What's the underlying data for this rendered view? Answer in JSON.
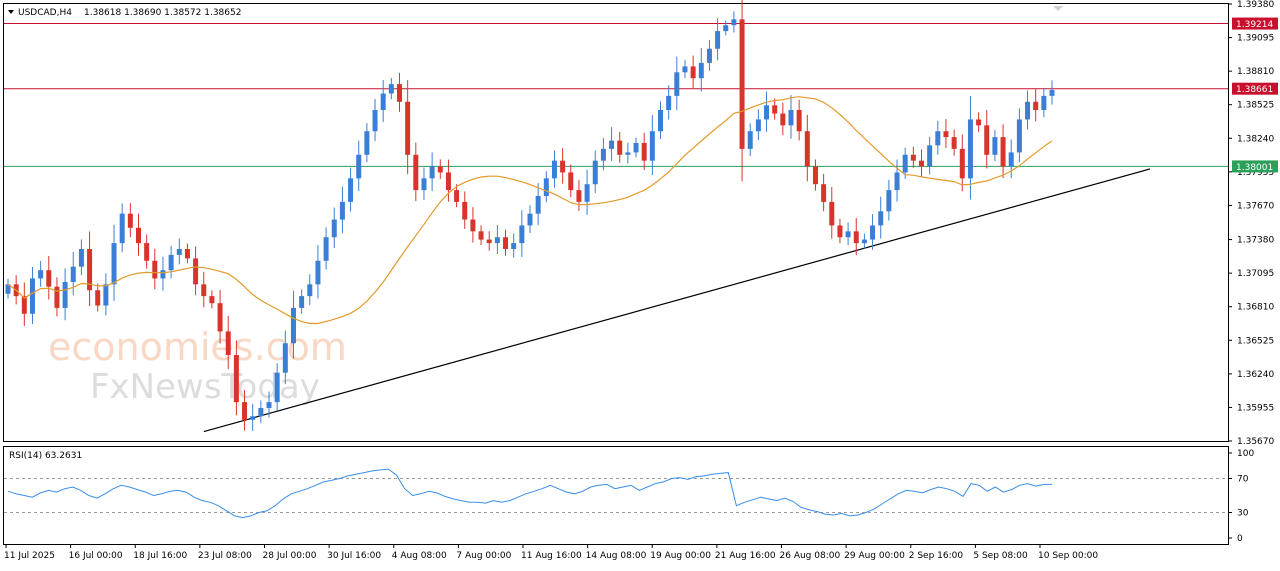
{
  "header": {
    "symbol": "USDCAD,H4",
    "ohlc": "1.38618 1.38690 1.38572 1.38652"
  },
  "watermark": {
    "line1": "economies.com",
    "line2": "FxNewsToday"
  },
  "colors": {
    "bull": "#3a7fd5",
    "bear": "#d9342b",
    "ma": "#e39a2b",
    "resistance": "#c8102e",
    "support": "#2aa05a",
    "trendline": "#000000",
    "rsi": "#3a8ee6"
  },
  "chart_data": [
    {
      "type": "candlestick",
      "title": "USDCAD,H4",
      "ylim": [
        1.3567,
        1.3938
      ],
      "y_ticks": [
        "1.39380",
        "1.39095",
        "1.38810",
        "1.38525",
        "1.38240",
        "1.37955",
        "1.37670",
        "1.37380",
        "1.37095",
        "1.36810",
        "1.36525",
        "1.36240",
        "1.35955",
        "1.35670"
      ],
      "x_ticks": [
        "11 Jul 2025",
        "16 Jul 00:00",
        "18 Jul 16:00",
        "23 Jul 08:00",
        "28 Jul 00:00",
        "30 Jul 16:00",
        "4 Aug 08:00",
        "7 Aug 00:00",
        "11 Aug 16:00",
        "14 Aug 08:00",
        "19 Aug 00:00",
        "21 Aug 16:00",
        "26 Aug 08:00",
        "29 Aug 00:00",
        "2 Sep 16:00",
        "5 Sep 08:00",
        "10 Sep 00:00"
      ],
      "closes": [
        1.37,
        1.369,
        1.3675,
        1.3705,
        1.3712,
        1.3698,
        1.368,
        1.3702,
        1.3715,
        1.373,
        1.3695,
        1.3682,
        1.37,
        1.3735,
        1.376,
        1.3748,
        1.3735,
        1.372,
        1.3705,
        1.3712,
        1.3725,
        1.373,
        1.3722,
        1.37,
        1.369,
        1.3684,
        1.366,
        1.364,
        1.36,
        1.3585,
        1.3588,
        1.3595,
        1.36,
        1.3625,
        1.365,
        1.368,
        1.369,
        1.37,
        1.372,
        1.374,
        1.3755,
        1.377,
        1.379,
        1.381,
        1.383,
        1.3848,
        1.3862,
        1.387,
        1.3855,
        1.381,
        1.378,
        1.379,
        1.38,
        1.3795,
        1.378,
        1.377,
        1.3755,
        1.3745,
        1.3738,
        1.3735,
        1.374,
        1.373,
        1.3735,
        1.375,
        1.376,
        1.3775,
        1.379,
        1.3805,
        1.3795,
        1.378,
        1.377,
        1.3785,
        1.3805,
        1.3815,
        1.3822,
        1.381,
        1.3812,
        1.382,
        1.3805,
        1.383,
        1.3848,
        1.386,
        1.388,
        1.3885,
        1.3875,
        1.3888,
        1.39,
        1.3915,
        1.392,
        1.3925,
        1.3815,
        1.383,
        1.384,
        1.3852,
        1.3845,
        1.3835,
        1.3848,
        1.383,
        1.38,
        1.3785,
        1.377,
        1.375,
        1.374,
        1.3745,
        1.3735,
        1.3738,
        1.375,
        1.3762,
        1.378,
        1.3795,
        1.381,
        1.3805,
        1.38,
        1.3818,
        1.383,
        1.3825,
        1.3815,
        1.379,
        1.384,
        1.3835,
        1.381,
        1.3825,
        1.38,
        1.3812,
        1.384,
        1.3855,
        1.3848,
        1.386,
        1.3865
      ],
      "ma_period": 21,
      "horizontal_levels": [
        {
          "value": 1.39214,
          "label": "1.39214"
        },
        {
          "value": 1.38661,
          "label": "1.38661"
        },
        {
          "value": 1.38001,
          "label": "1.38001"
        }
      ],
      "trendline": {
        "from": [
          "23 Jul 08:00",
          1.3575
        ],
        "to": [
          "10 Sep 00:00",
          1.3798
        ]
      }
    },
    {
      "type": "line",
      "title": "RSI(14) 63.2631",
      "ylim": [
        0,
        100
      ],
      "y_ticks": [
        "100",
        "70",
        "30",
        "0"
      ],
      "levels": [
        70,
        30
      ],
      "values": [
        55,
        52,
        50,
        48,
        53,
        56,
        54,
        58,
        60,
        56,
        50,
        47,
        52,
        58,
        62,
        60,
        57,
        54,
        50,
        52,
        55,
        56,
        54,
        48,
        44,
        42,
        38,
        32,
        26,
        24,
        26,
        30,
        32,
        38,
        46,
        52,
        55,
        58,
        62,
        66,
        68,
        70,
        73,
        75,
        77,
        79,
        80,
        81,
        74,
        58,
        50,
        52,
        55,
        53,
        49,
        46,
        44,
        42,
        42,
        41,
        44,
        42,
        44,
        48,
        52,
        55,
        58,
        62,
        58,
        54,
        52,
        55,
        60,
        62,
        63,
        58,
        60,
        62,
        56,
        60,
        64,
        66,
        70,
        71,
        69,
        72,
        73,
        75,
        76,
        77,
        38,
        42,
        45,
        48,
        46,
        44,
        47,
        43,
        36,
        33,
        31,
        28,
        27,
        29,
        26,
        27,
        30,
        34,
        40,
        46,
        52,
        56,
        55,
        53,
        57,
        60,
        58,
        55,
        49,
        64,
        62,
        55,
        60,
        54,
        57,
        62,
        64,
        61,
        63,
        63
      ]
    }
  ]
}
